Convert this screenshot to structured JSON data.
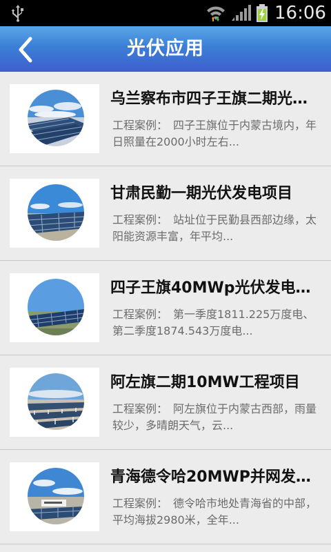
{
  "status_bar": {
    "time": "16:06",
    "icons": [
      "usb-icon",
      "wifi-icon",
      "signal-icon",
      "battery-charging-icon"
    ]
  },
  "header": {
    "title": "光伏应用",
    "back_icon": "chevron-left-icon"
  },
  "projects": [
    {
      "title": "乌兰察布市四子王旗二期光…",
      "description": "工程案例：　四子王旗位于内蒙古境内，年日照量在2000小时左右..."
    },
    {
      "title": "甘肃民勤一期光伏发电项目",
      "description": "工程案例：　站址位于民勤县西部边缘，太阳能资源丰富，年平均..."
    },
    {
      "title": "四子王旗40MWp光伏发电…",
      "description": "工程案例：　第一季度1811.225万度电、第二季度1874.543万度电..."
    },
    {
      "title": "阿左旗二期10MW工程项目",
      "description": "工程案例：　阿左旗位于内蒙古西部，雨量较少，多晴朗天气，云..."
    },
    {
      "title": "青海德令哈20MWP并网发…",
      "description": "工程案例：　德令哈市地处青海省的中部，平均海拔2980米，全年..."
    }
  ],
  "colors": {
    "status_bar": "#000000",
    "header_top": "#5ba6e8",
    "header_bottom": "#3f5fcf",
    "list_background": "#ececec",
    "title_text": "#111111",
    "description_text": "#6b6b6b"
  }
}
